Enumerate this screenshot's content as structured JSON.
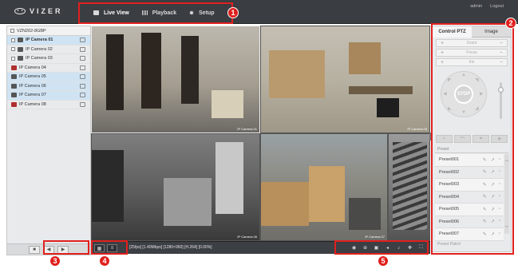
{
  "app": {
    "logo_text": "VIZER",
    "nav": [
      {
        "label": "Live View",
        "icon": "monitor-icon",
        "active": true
      },
      {
        "label": "Playback",
        "icon": "film-icon",
        "active": false
      },
      {
        "label": "Setup",
        "icon": "gear-icon",
        "active": false
      }
    ],
    "user": "admin",
    "logout": "Logout"
  },
  "sidebar": {
    "device": "VZN202-8GBP",
    "cameras": [
      {
        "label": "IP Camera 01",
        "selected": true,
        "bold": true,
        "offline": false
      },
      {
        "label": "IP Camera 02",
        "selected": false,
        "bold": false,
        "offline": false
      },
      {
        "label": "IP Camera 03",
        "selected": false,
        "bold": false,
        "offline": false
      },
      {
        "label": "IP Camera 04",
        "selected": false,
        "bold": false,
        "offline": true
      },
      {
        "label": "IP Camera 05",
        "selected": true,
        "bold": false,
        "offline": false
      },
      {
        "label": "IP Camera 06",
        "selected": true,
        "bold": false,
        "offline": false
      },
      {
        "label": "IP Camera 07",
        "selected": true,
        "bold": false,
        "offline": false
      },
      {
        "label": "IP Camera 08",
        "selected": false,
        "bold": false,
        "offline": true
      }
    ],
    "bottom_buttons": [
      "■",
      "◀",
      "▶"
    ]
  },
  "video": {
    "stream_info": "[25fps] [1.40Mbps] [1280×960] [H.264] [0.00%]",
    "tiles": [
      {
        "name": "IP Camera 01"
      },
      {
        "name": "IP Camera 05"
      },
      {
        "name": "IP Camera 06"
      },
      {
        "name": "IP Camera 07"
      },
      {
        "name": ""
      }
    ]
  },
  "ptz": {
    "tabs": [
      "Control PTZ",
      "Image"
    ],
    "rows": [
      "Zoom",
      "Focus",
      "Iris"
    ],
    "stop_label": "STOP",
    "preset_header": "Preset",
    "presets": [
      "Preset001",
      "Preset002",
      "Preset003",
      "Preset004",
      "Preset005",
      "Preset006",
      "Preset007"
    ],
    "patrol_header": "Preset Patrol"
  },
  "annotations": [
    "1",
    "2",
    "3",
    "4",
    "5"
  ],
  "colors": {
    "annotation": "#e0201e",
    "topbar": "#3a3d42",
    "selected_row": "#cfe3f3"
  }
}
